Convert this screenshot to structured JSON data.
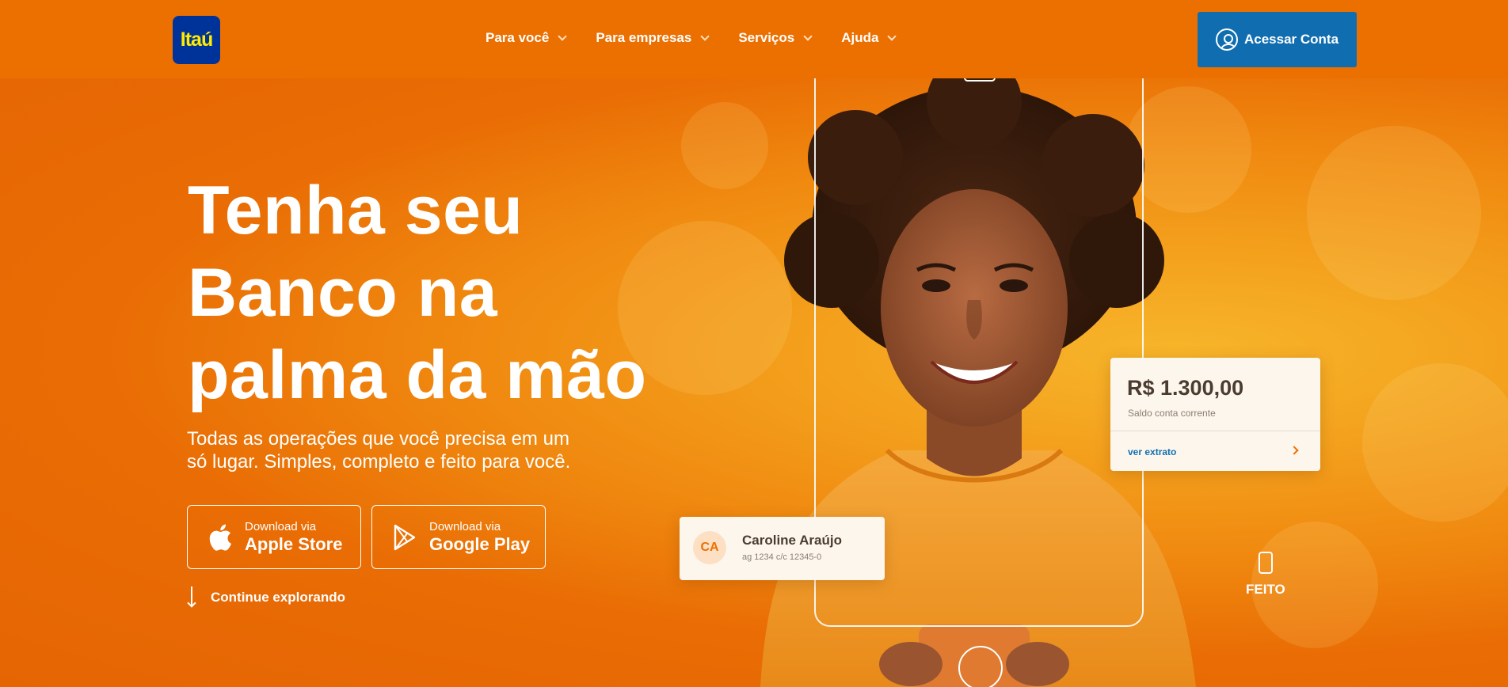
{
  "header": {
    "logo_text": "Itaú",
    "nav": [
      {
        "label": "Para você"
      },
      {
        "label": "Para empresas"
      },
      {
        "label": "Serviços"
      },
      {
        "label": "Ajuda"
      }
    ],
    "login_label": "Acessar Conta"
  },
  "hero": {
    "headline_line1": "Tenha seu",
    "headline_line2": "Banco na",
    "headline_line3": "palma da mão",
    "subtitle_line1": "Todas as operações que você precisa em um",
    "subtitle_line2": "só lugar. Simples, completo e feito para você.",
    "apple": {
      "small": "Download via",
      "big": "Apple Store"
    },
    "google": {
      "small": "Download via",
      "big": "Google Play"
    },
    "explore_label": "Continue explorando",
    "feito_label": "FEITO"
  },
  "balance_card": {
    "amount": "R$ 1.300,00",
    "label": "Saldo conta corrente",
    "link": "ver extrato"
  },
  "profile_card": {
    "initials": "CA",
    "name": "Caroline Araújo",
    "account": "ag 1234   c/c 12345-0"
  },
  "colors": {
    "brand_orange": "#ec7000",
    "login_blue": "#106eb0",
    "logo_blue": "#003399",
    "logo_yellow": "#ffec00"
  }
}
